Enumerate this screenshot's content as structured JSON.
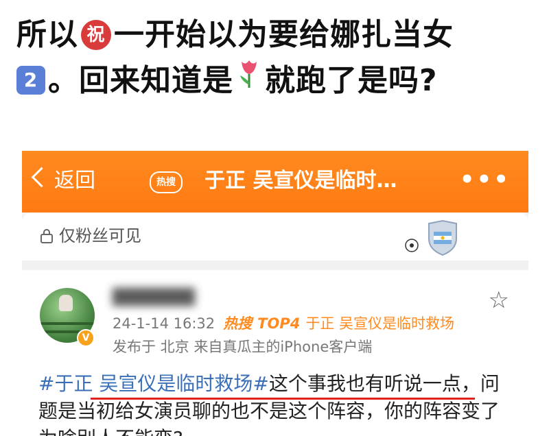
{
  "caption": {
    "part1": "所以",
    "emoji1": "祝",
    "part2": "一开始以为要给娜扎当女",
    "emoji2": "2",
    "part3": "。回来知道是",
    "part4": "就跑了是吗?"
  },
  "topbar": {
    "back_label": "返回",
    "hot_tag": "热搜",
    "title": "于正 吴宣仪是临时…",
    "more": "•••"
  },
  "card": {
    "visibility": "仅粉丝可见"
  },
  "post": {
    "username": "▇▇▇▇▇▇",
    "date": "24-1-14 16:32",
    "hot_label": "热搜",
    "rank": "TOP4",
    "topic": "于正 吴宣仪是临时救场",
    "source": "发布于 北京  来自真瓜主的iPhone客户端",
    "text_tag": "#于正 吴宣仪是临时救场#",
    "text_rest": "这个事我也有听说一点，问题是当初给女演员聊的也不是这个阵容，你的阵容变了为啥别人不能变?"
  },
  "colors": {
    "accent": "#ff8a1f",
    "link": "#3a6fb8",
    "underline": "#e02020"
  },
  "icons": {
    "back": "chevron-left-icon",
    "lock": "lock-icon",
    "star": "star-icon",
    "verified": "verified-badge-icon"
  }
}
